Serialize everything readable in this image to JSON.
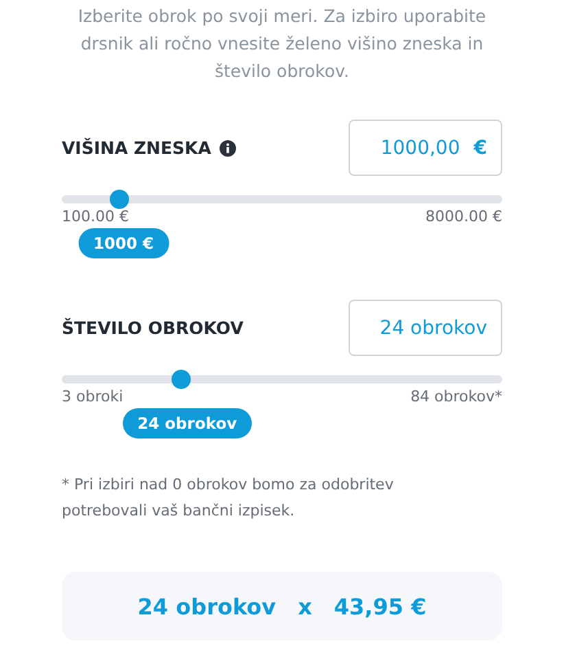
{
  "intro": "Izberite obrok po svoji meri. Za izbiro uporabite drsnik ali ročno vnesite želeno višino zneska in število obrokov.",
  "sliders": [
    {
      "label": "VIŠINA ZNESKA",
      "info": true,
      "value": "1000,00",
      "unit": "€",
      "level": 0.13,
      "min": "100.00 €",
      "max": "8000.00 €",
      "bubble": "1000 €"
    },
    {
      "label": "ŠTEVILO OBROKOV",
      "value": "24 obrokov",
      "level": 0.27,
      "min": "3 obroki",
      "max": "84 obrokov*",
      "bubble": "24 obrokov"
    }
  ],
  "note": "* Pri izbiri nad 0 obrokov bomo za odobritev potrebovali vaš bančni izpisek.",
  "summary": {
    "count": "24 obrokov",
    "times": "x",
    "amount": "43,95 €"
  }
}
